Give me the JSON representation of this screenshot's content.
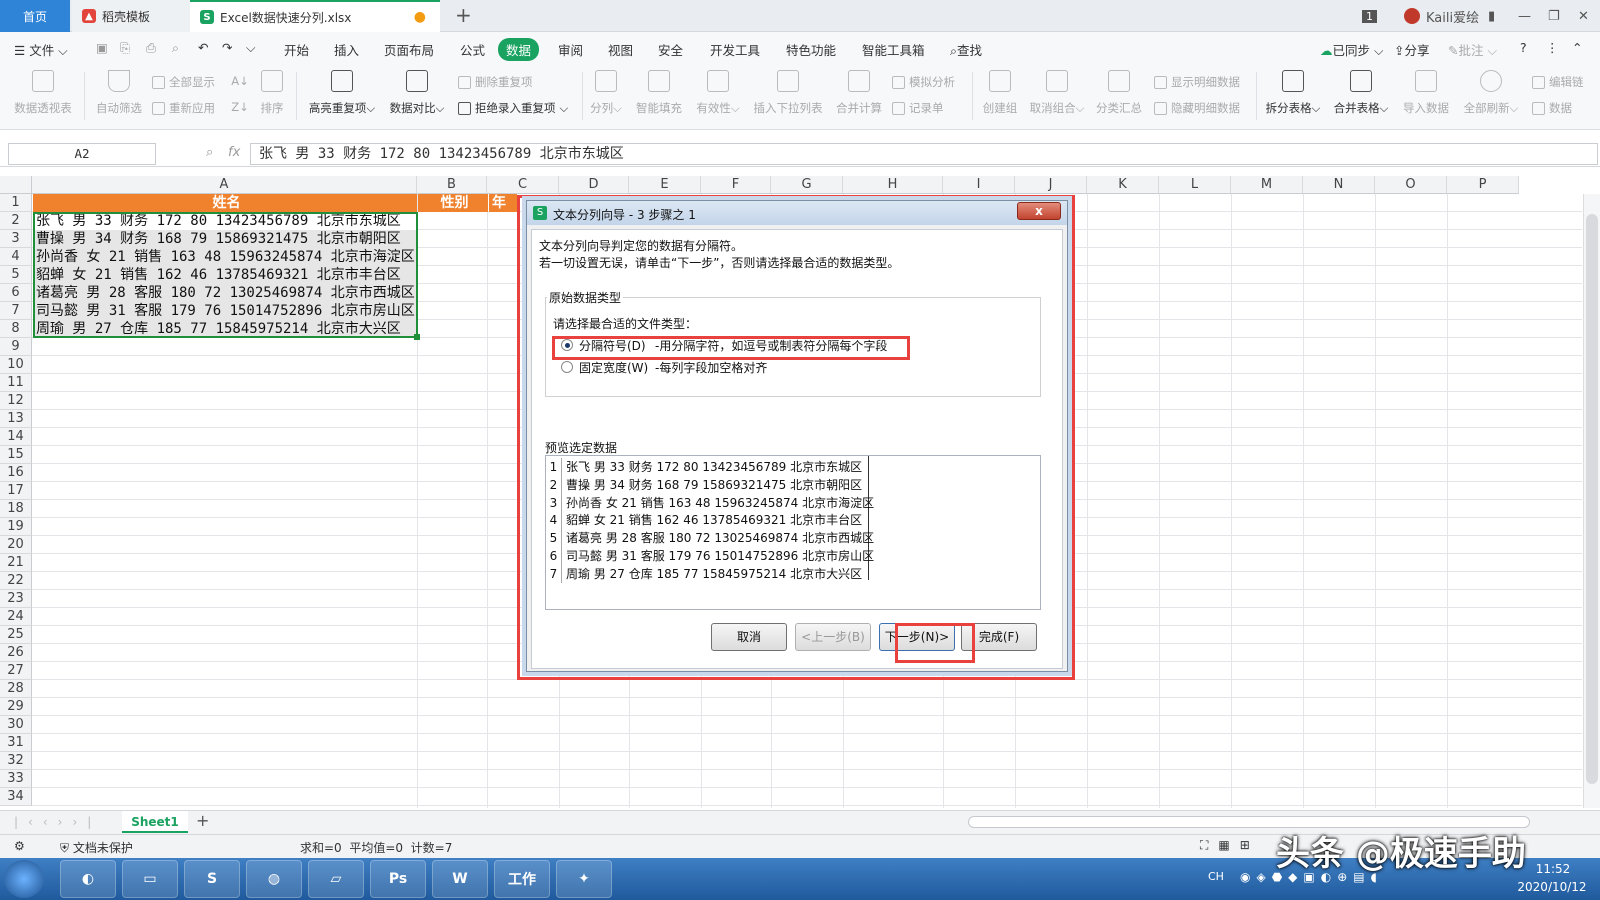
{
  "tabs": {
    "home": "首页",
    "template": "稻壳模板",
    "file": "Excel数据快速分列.xlsx",
    "badge": "1",
    "user": "Kaili爱绘"
  },
  "menu": {
    "file": "文件",
    "items": [
      "开始",
      "插入",
      "页面布局",
      "公式",
      "数据",
      "审阅",
      "视图",
      "安全",
      "开发工具",
      "特色功能",
      "智能工具箱"
    ],
    "find": "查找",
    "sync": "已同步",
    "share": "分享",
    "comment": "批注"
  },
  "ribbon": {
    "pivot": "数据透视表",
    "autofilter": "自动筛选",
    "show_all": "全部显示",
    "reapply": "重新应用",
    "sort": "排序",
    "highlight_dup": "高亮重复项",
    "compare": "数据对比",
    "delete_dup": "删除重复项",
    "reject_dup": "拒绝录入重复项",
    "split": "分列",
    "smart_fill": "智能填充",
    "validity": "有效性",
    "insert_dropdown": "插入下拉列表",
    "merge_calc": "合并计算",
    "simulate": "模拟分析",
    "record": "记录单",
    "create_group": "创建组",
    "ungroup": "取消组合",
    "subtotal": "分类汇总",
    "show_detail": "显示明细数据",
    "hide_detail": "隐藏明细数据",
    "split_table": "拆分表格",
    "merge_table": "合并表格",
    "import": "导入数据",
    "refresh_all": "全部刷新",
    "edit_link": "编辑链",
    "data_s": "数据"
  },
  "formula": {
    "namebox": "A2",
    "fx": "fx",
    "content": "张飞 男 33 财务 172 80 13423456789 北京市东城区"
  },
  "grid": {
    "columns": [
      "A",
      "B",
      "C",
      "D",
      "E",
      "F",
      "G",
      "H",
      "I",
      "J",
      "K",
      "L",
      "M",
      "N",
      "O",
      "P"
    ],
    "rows": [
      "1",
      "2",
      "3",
      "4",
      "5",
      "6",
      "7",
      "8",
      "9",
      "10",
      "11",
      "12",
      "13",
      "14",
      "15",
      "16",
      "17",
      "18",
      "19",
      "20",
      "21",
      "22",
      "23",
      "24",
      "25",
      "26",
      "27",
      "28",
      "29",
      "30",
      "31",
      "32",
      "33",
      "34"
    ],
    "header_a": "姓名",
    "header_b": "性别",
    "header_c": "年",
    "data": [
      "张飞 男 33 财务 172 80 13423456789 北京市东城区",
      "曹操 男 34 财务 168 79 15869321475 北京市朝阳区",
      "孙尚香 女 21 销售 163 48 15963245874 北京市海淀区",
      "貂蝉 女 21 销售 162 46 13785469321 北京市丰台区",
      "诸葛亮 男 28 客服 180 72 13025469874 北京市西城区",
      "司马懿 男 31 客服 179 76 15014752896 北京市房山区",
      "周瑜 男 27 仓库 185 77 15845975214 北京市大兴区"
    ]
  },
  "dialog": {
    "title": "文本分列向导 - 3 步骤之 1",
    "line1": "文本分列向导判定您的数据有分隔符。",
    "line2": "若一切设置无误，请单击“下一步”，否则请选择最合适的数据类型。",
    "group_label": "原始数据类型",
    "choose_label": "请选择最合适的文件类型：",
    "opt_delim": "分隔符号(D)",
    "opt_delim_desc": "-用分隔字符，如逗号或制表符分隔每个字段",
    "opt_fixed": "固定宽度(W)",
    "opt_fixed_desc": "-每列字段加空格对齐",
    "preview_label": "预览选定数据",
    "preview": [
      {
        "n": "1",
        "t": "张飞 男 33 财务 172 80 13423456789 北京市东城区"
      },
      {
        "n": "2",
        "t": "曹操 男 34 财务 168 79 15869321475 北京市朝阳区"
      },
      {
        "n": "3",
        "t": "孙尚香 女 21 销售 163 48 15963245874 北京市海淀区"
      },
      {
        "n": "4",
        "t": "貂蝉 女 21 销售 162 46 13785469321 北京市丰台区"
      },
      {
        "n": "5",
        "t": "诸葛亮 男 28 客服 180 72 13025469874 北京市西城区"
      },
      {
        "n": "6",
        "t": "司马懿 男 31 客服 179 76 15014752896 北京市房山区"
      },
      {
        "n": "7",
        "t": "周瑜 男 27 仓库 185 77 15845975214 北京市大兴区"
      }
    ],
    "cancel": "取消",
    "prev": "<上一步(B)",
    "next": "下一步(N)>",
    "finish": "完成(F)",
    "close": "x"
  },
  "sheet": {
    "tab": "Sheet1"
  },
  "status": {
    "protect": "文档未保护",
    "stats": "求和=0  平均值=0  计数=7"
  },
  "taskbar": {
    "watermark": "头条 @极速手助",
    "lang": "CH",
    "time": "11:52",
    "date": "2020/10/12",
    "ps": "Ps",
    "w": "W",
    "work": "工作"
  },
  "colors": {
    "accent": "#1aa260",
    "header_fill": "#f0822e",
    "highlight_red": "#e8413e",
    "selection": "#1f8f3a"
  }
}
